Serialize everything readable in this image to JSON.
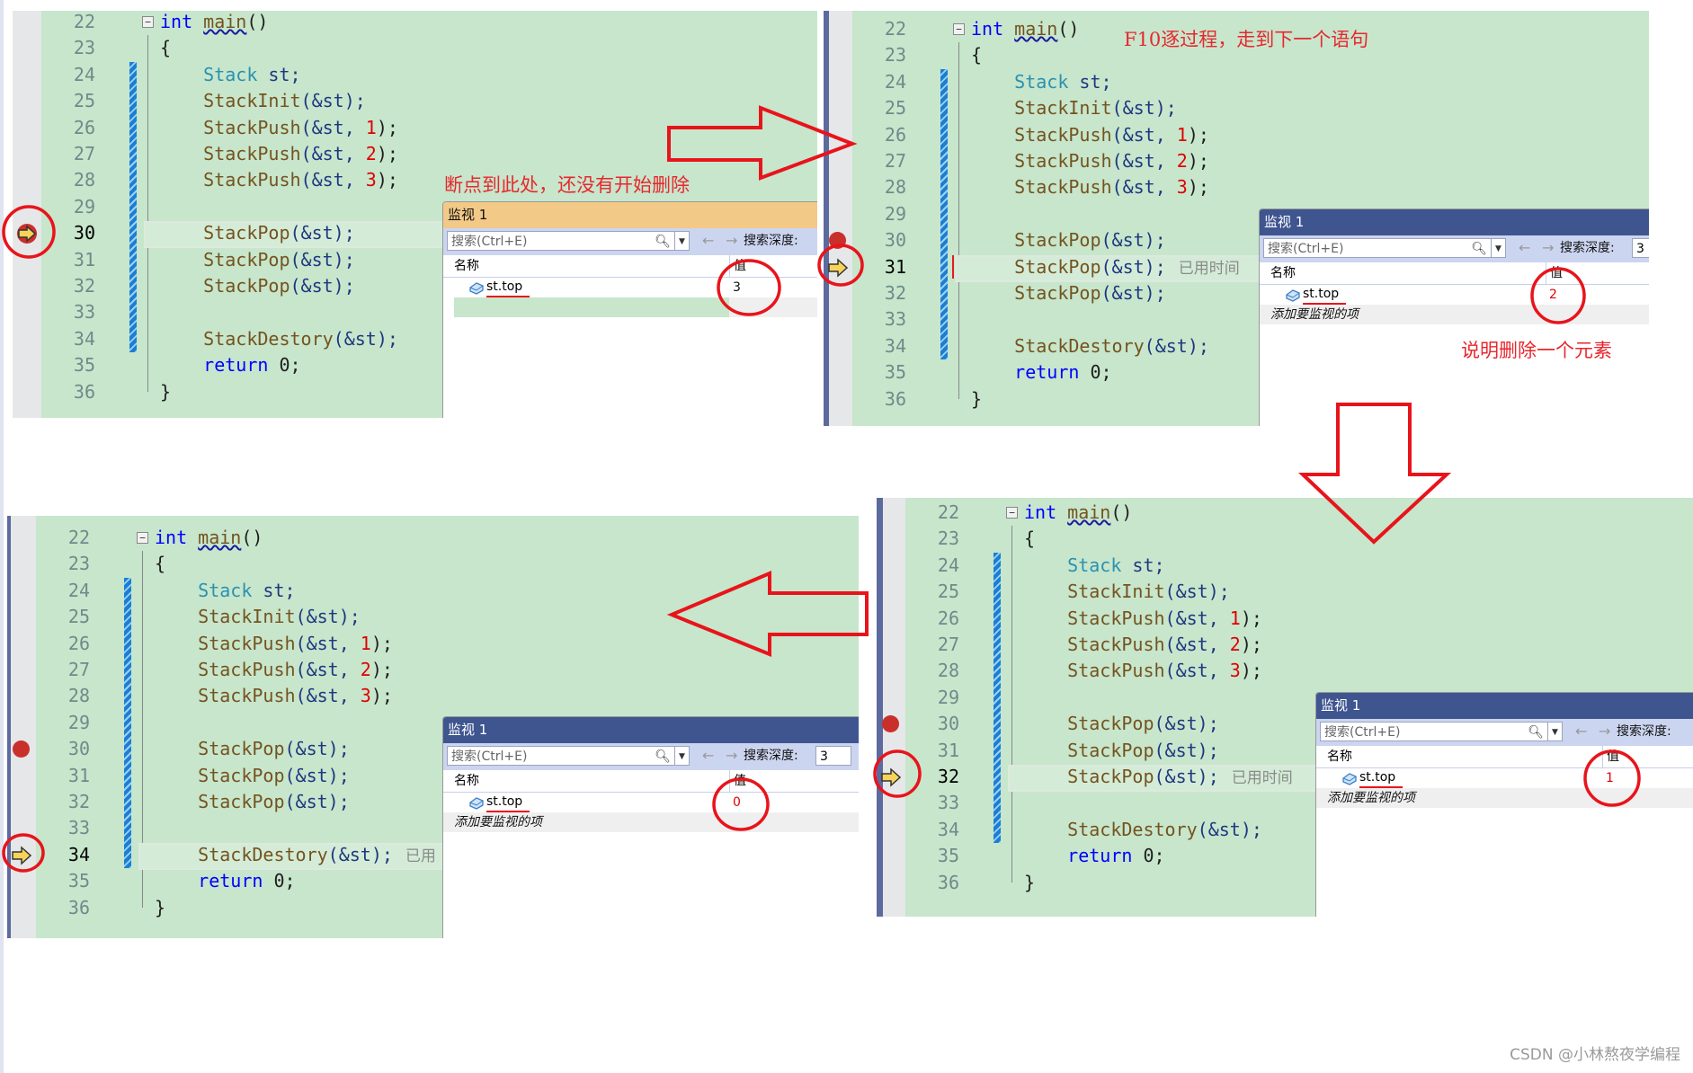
{
  "code": {
    "line_numbers": [
      22,
      23,
      24,
      25,
      26,
      27,
      28,
      29,
      30,
      31,
      32,
      33,
      34,
      35,
      36
    ],
    "lines": [
      [
        [
          "int",
          "kw"
        ],
        [
          " ",
          ""
        ],
        [
          "main",
          "sq"
        ],
        [
          "()",
          ""
        ]
      ],
      [
        [
          "{",
          ""
        ]
      ],
      [
        [
          "    ",
          ""
        ],
        [
          "Stack",
          "ty"
        ],
        [
          " st;",
          "var"
        ]
      ],
      [
        [
          "    ",
          ""
        ],
        [
          "StackInit",
          "fn"
        ],
        [
          "(&st);",
          "var"
        ]
      ],
      [
        [
          "    ",
          ""
        ],
        [
          "StackPush",
          "fn"
        ],
        [
          "(&st, ",
          "var"
        ],
        [
          "1",
          "num"
        ],
        [
          ");",
          ""
        ]
      ],
      [
        [
          "    ",
          ""
        ],
        [
          "StackPush",
          "fn"
        ],
        [
          "(&st, ",
          "var"
        ],
        [
          "2",
          "num"
        ],
        [
          ");",
          ""
        ]
      ],
      [
        [
          "    ",
          ""
        ],
        [
          "StackPush",
          "fn"
        ],
        [
          "(&st, ",
          "var"
        ],
        [
          "3",
          "num"
        ],
        [
          ");",
          ""
        ]
      ],
      [],
      [
        [
          "    ",
          ""
        ],
        [
          "StackPop",
          "fn"
        ],
        [
          "(&st);",
          "var"
        ]
      ],
      [
        [
          "    ",
          ""
        ],
        [
          "StackPop",
          "fn"
        ],
        [
          "(&st);",
          "var"
        ]
      ],
      [
        [
          "    ",
          ""
        ],
        [
          "StackPop",
          "fn"
        ],
        [
          "(&st);",
          "var"
        ]
      ],
      [],
      [
        [
          "    ",
          ""
        ],
        [
          "StackDestory",
          "fn"
        ],
        [
          "(&st);",
          "var"
        ]
      ],
      [
        [
          "    ",
          ""
        ],
        [
          "return",
          "kw"
        ],
        [
          " 0;",
          ""
        ]
      ],
      [
        [
          "}",
          ""
        ]
      ]
    ]
  },
  "watch_common": {
    "search_placeholder": "搜索(Ctrl+E)",
    "back": "←",
    "forward": "→",
    "depth_label": "搜索深度:",
    "col_name": "名称",
    "col_value": "值",
    "add_item": "添加要监视的项"
  },
  "panels": [
    {
      "current_line": 30,
      "breakpoint_line": 30,
      "hint": "",
      "watch": {
        "title": "监视 1",
        "header_color": "#f2c987",
        "header_text_color": "#111111",
        "name": "st.top",
        "value": "3",
        "value_color": "#111111",
        "depth": "",
        "show_add_item": false
      }
    },
    {
      "current_line": 31,
      "breakpoint_line": 30,
      "hint": "已用时间",
      "watch": {
        "title": "监视 1",
        "header_color": "#3f5590",
        "header_text_color": "#ffffff",
        "name": "st.top",
        "value": "2",
        "value_color": "#e00000",
        "depth": "3",
        "show_add_item": true
      }
    },
    {
      "current_line": 34,
      "breakpoint_line": 30,
      "hint": "已用",
      "watch": {
        "title": "监视 1",
        "header_color": "#3f5590",
        "header_text_color": "#ffffff",
        "name": "st.top",
        "value": "0",
        "value_color": "#e00000",
        "depth": "3",
        "show_add_item": true
      }
    },
    {
      "current_line": 32,
      "breakpoint_line": 30,
      "hint": "已用时间",
      "watch": {
        "title": "监视 1",
        "header_color": "#3f5590",
        "header_text_color": "#ffffff",
        "name": "st.top",
        "value": "1",
        "value_color": "#e00000",
        "depth": "",
        "show_add_item": true
      }
    }
  ],
  "annotations": {
    "breakpoint_note": "断点到此处，还没有开始删除",
    "f10_note": "F10逐过程，走到下一个语句",
    "deleted_note": "说明删除一个元素"
  },
  "watermark": "CSDN @小林熬夜学编程",
  "accent_red": "#e8141b"
}
